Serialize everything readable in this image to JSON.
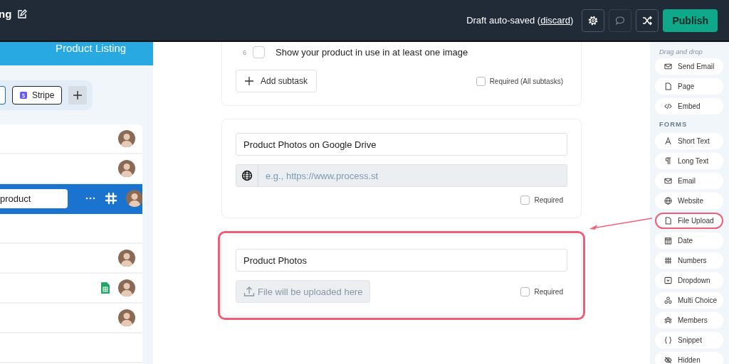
{
  "topbar": {
    "title": "ng",
    "status": "Draft auto-saved (",
    "discard_link": "discard",
    "status_end": ")",
    "publish": "Publish"
  },
  "left_panel": {
    "header": "Product Listing",
    "integrations": [
      {
        "kind": "stripe",
        "label": "Stripe"
      }
    ],
    "rows": [
      {
        "kind": "plain",
        "selected": false,
        "avatar": true
      },
      {
        "kind": "plain",
        "selected": false,
        "avatar": true
      },
      {
        "kind": "slack",
        "selected": true,
        "avatar": true,
        "value": "product"
      },
      {
        "kind": "plain",
        "selected": false,
        "avatar": false
      },
      {
        "kind": "plain",
        "selected": false,
        "avatar": true
      },
      {
        "kind": "sheets",
        "selected": false,
        "avatar": true
      },
      {
        "kind": "plain",
        "selected": false,
        "avatar": true
      },
      {
        "kind": "plain",
        "selected": false,
        "avatar": false
      }
    ]
  },
  "editor": {
    "subtask": {
      "number": "6",
      "checked": false,
      "text": "Show your product in use in at least one image",
      "add_button": "Add subtask",
      "required_label": "Required (All subtasks)",
      "required": false
    },
    "cards": [
      {
        "kind": "website",
        "highlighted": false,
        "title": "Product Photos on Google Drive",
        "placeholder": "e.g., https://www.process.st",
        "required_label": "Required",
        "required": false
      },
      {
        "kind": "file",
        "highlighted": true,
        "title": "Product Photos",
        "upload_label": "File will be uploaded here",
        "required_label": "Required",
        "required": false
      }
    ]
  },
  "sidebar": {
    "hint": "Drag and drop",
    "sections": [
      {
        "items": [
          {
            "label": "Send Email",
            "kind": "mail",
            "highlighted": false
          },
          {
            "label": "Page",
            "kind": "page",
            "highlighted": false
          },
          {
            "label": "Embed",
            "kind": "code",
            "highlighted": false
          }
        ]
      },
      {
        "title": "FORMS",
        "items": [
          {
            "label": "Short Text",
            "kind": "A",
            "highlighted": false
          },
          {
            "label": "Long Text",
            "kind": "para",
            "highlighted": false
          },
          {
            "label": "Email",
            "kind": "mail",
            "highlighted": false
          },
          {
            "label": "Website",
            "kind": "globe",
            "highlighted": false
          },
          {
            "label": "File Upload",
            "kind": "file",
            "highlighted": true
          },
          {
            "label": "Date",
            "kind": "date",
            "highlighted": false
          },
          {
            "label": "Numbers",
            "kind": "num",
            "highlighted": false
          },
          {
            "label": "Dropdown",
            "kind": "drop",
            "highlighted": false
          },
          {
            "label": "Multi Choice",
            "kind": "multi",
            "highlighted": false
          },
          {
            "label": "Members",
            "kind": "members",
            "highlighted": false
          },
          {
            "label": "Snippet",
            "kind": "snippet",
            "highlighted": false
          },
          {
            "label": "Hidden",
            "kind": "hidden",
            "highlighted": false
          }
        ]
      }
    ]
  }
}
